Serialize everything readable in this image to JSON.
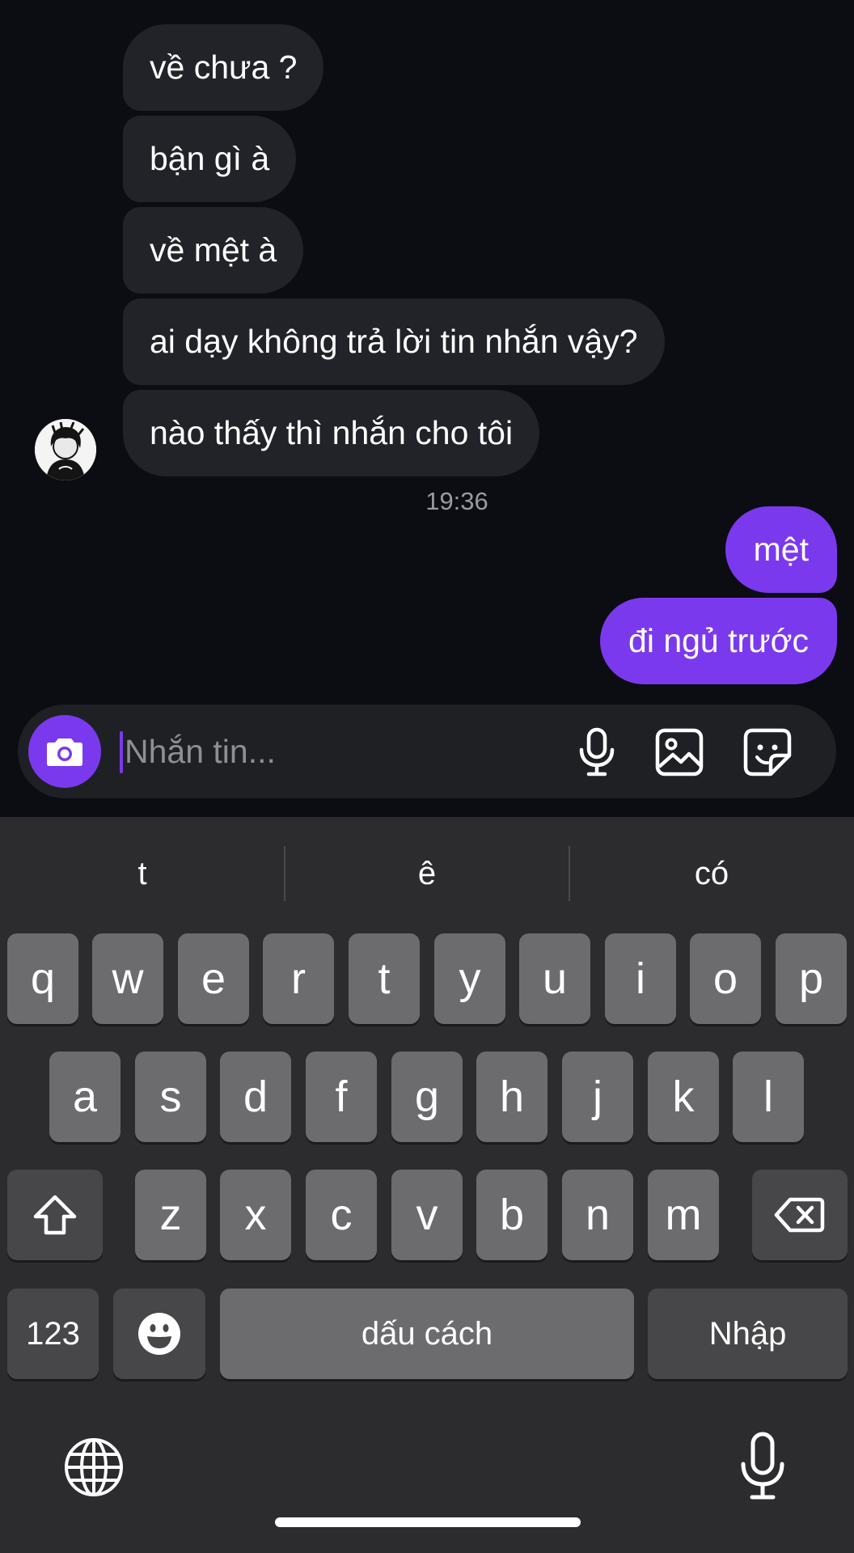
{
  "messages_in": [
    {
      "text": "về chưa ?"
    },
    {
      "text": "bận gì à"
    },
    {
      "text": "về mệt à"
    },
    {
      "text": "ai dạy không trả lời tin nhắn vậy?"
    },
    {
      "text": "nào thấy thì nhắn cho tôi"
    }
  ],
  "timestamp": "19:36",
  "messages_out": [
    {
      "text": "mệt"
    },
    {
      "text": "đi ngủ trước"
    }
  ],
  "composer": {
    "placeholder": "Nhắn tin...",
    "icons": [
      "camera-icon",
      "microphone-icon",
      "image-icon",
      "sticker-icon"
    ]
  },
  "keyboard": {
    "suggestions": [
      "t",
      "ê",
      "có"
    ],
    "row1": [
      "q",
      "w",
      "e",
      "r",
      "t",
      "y",
      "u",
      "i",
      "o",
      "p"
    ],
    "row2": [
      "a",
      "s",
      "d",
      "f",
      "g",
      "h",
      "j",
      "k",
      "l"
    ],
    "row3": [
      "z",
      "x",
      "c",
      "v",
      "b",
      "n",
      "m"
    ],
    "numbers_key": "123",
    "space_key": "dấu cách",
    "return_key": "Nhập",
    "icons": [
      "shift-icon",
      "backspace-icon",
      "emoji-icon",
      "globe-icon",
      "dictation-icon"
    ]
  },
  "colors": {
    "accent": "#7b39ee",
    "background": "#0b0d12",
    "incoming_bubble": "#222328",
    "keyboard_bg": "#2c2c2f",
    "key": "#6c6c6f",
    "key_dark": "#474749"
  }
}
